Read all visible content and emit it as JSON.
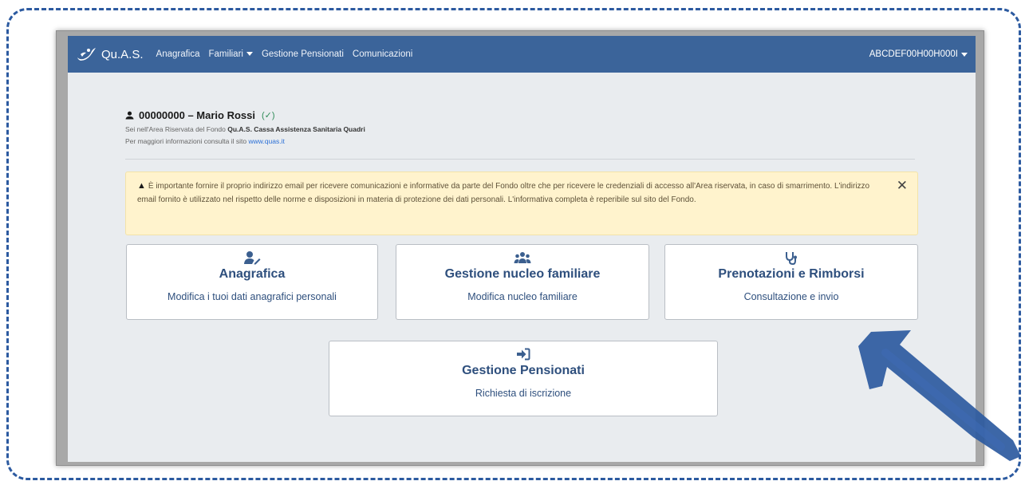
{
  "navbar": {
    "brand": "Qu.A.S.",
    "links": [
      "Anagrafica",
      "Familiari",
      "Gestione Pensionati",
      "Comunicazioni"
    ],
    "user": "ABCDEF00H00H000I"
  },
  "profile": {
    "title": "00000000 – Mario Rossi",
    "status": "(✓)",
    "line1_prefix": "Sei nell'Area Riservata del Fondo ",
    "line1_bold": "Qu.A.S. Cassa Assistenza Sanitaria Quadri",
    "line2_prefix": "Per maggiori informazioni consulta il sito ",
    "line2_link": "www.quas.it"
  },
  "alert": {
    "icon": "warning-icon",
    "text": "È importante fornire il proprio indirizzo email per ricevere comunicazioni e informative da parte del Fondo oltre che per ricevere le credenziali di accesso all'Area riservata, in caso di smarrimento. L'indirizzo email fornito è utilizzato nel rispetto delle norme e disposizioni in materia di protezione dei dati personali. L'informativa completa è reperibile sul sito del Fondo.",
    "close": "✕"
  },
  "cards": [
    {
      "icon": "user-edit-icon",
      "title": "Anagrafica",
      "subtitle": "Modifica i tuoi dati anagrafici personali"
    },
    {
      "icon": "users-icon",
      "title": "Gestione nucleo familiare",
      "subtitle": "Modifica nucleo familiare"
    },
    {
      "icon": "stethoscope-icon",
      "title": "Prenotazioni e Rimborsi",
      "subtitle": "Consultazione e invio"
    },
    {
      "icon": "sign-in-icon",
      "title": "Gestione Pensionati",
      "subtitle": "Richiesta di iscrizione"
    }
  ],
  "colors": {
    "navbar": "#3b649a",
    "card_text": "#2e4f7d",
    "alert_bg": "#fff3cd",
    "annotation": "#2c5aa0"
  }
}
